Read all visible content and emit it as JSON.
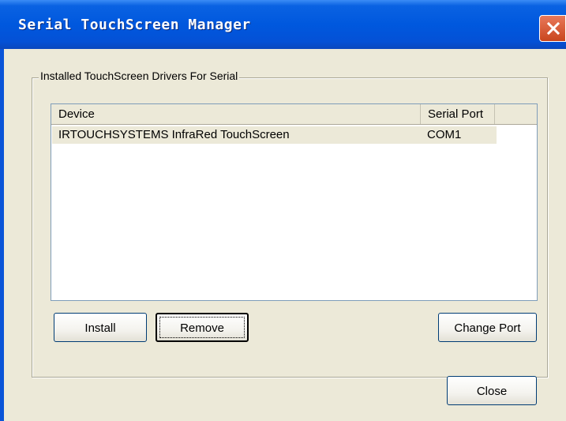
{
  "window": {
    "title": "Serial TouchScreen Manager",
    "close_icon": "close-icon"
  },
  "groupbox": {
    "label": "Installed TouchScreen Drivers For Serial"
  },
  "list": {
    "columns": [
      "Device",
      "Serial Port"
    ],
    "rows": [
      {
        "device": "IRTOUCHSYSTEMS InfraRed TouchScreen",
        "port": "COM1",
        "selected": true
      }
    ]
  },
  "buttons": {
    "install": "Install",
    "remove": "Remove",
    "change_port": "Change Port",
    "close": "Close"
  },
  "colors": {
    "titlebar": "#0058de",
    "dialog_bg": "#ece9d8",
    "close_button": "#c9461e",
    "button_border": "#003c74"
  }
}
